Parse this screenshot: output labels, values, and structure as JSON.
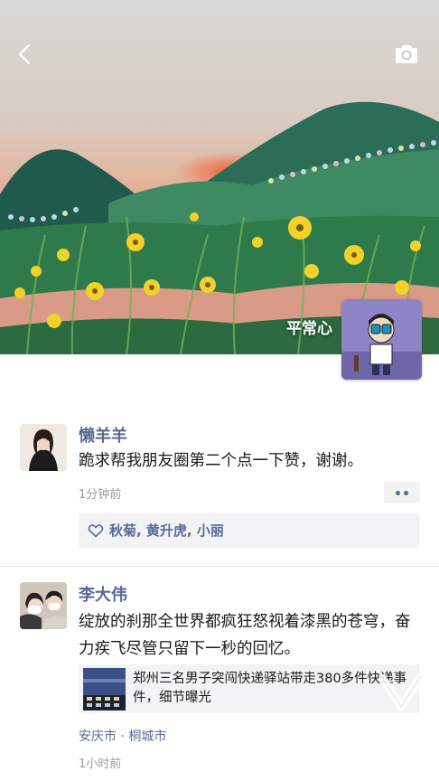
{
  "profile": {
    "nickname": "平常心"
  },
  "icons": {
    "back": "chevron-left-icon",
    "camera": "camera-icon",
    "like": "heart-icon",
    "more": "ellipsis-icon"
  },
  "colors": {
    "link_blue": "#576b95",
    "time_gray": "#9b9b9b",
    "panel_bg": "#f3f3f5"
  },
  "posts": [
    {
      "author": "懒羊羊",
      "text": "跪求帮我朋友圈第二个点一下赞，谢谢。",
      "time": "1分钟前",
      "likes": "秋菊, 黄升虎, 小丽"
    },
    {
      "author": "李大伟",
      "text": "绽放的刹那全世界都疯狂怒视着漆黑的苍穹，奋力疾飞尽管只留下一秒的回忆。",
      "link_title": "郑州三名男子突闯快递驿站带走380多件快递事件，细节曝光",
      "location": "安庆市 · 桐城市",
      "time": "1小时前"
    }
  ]
}
